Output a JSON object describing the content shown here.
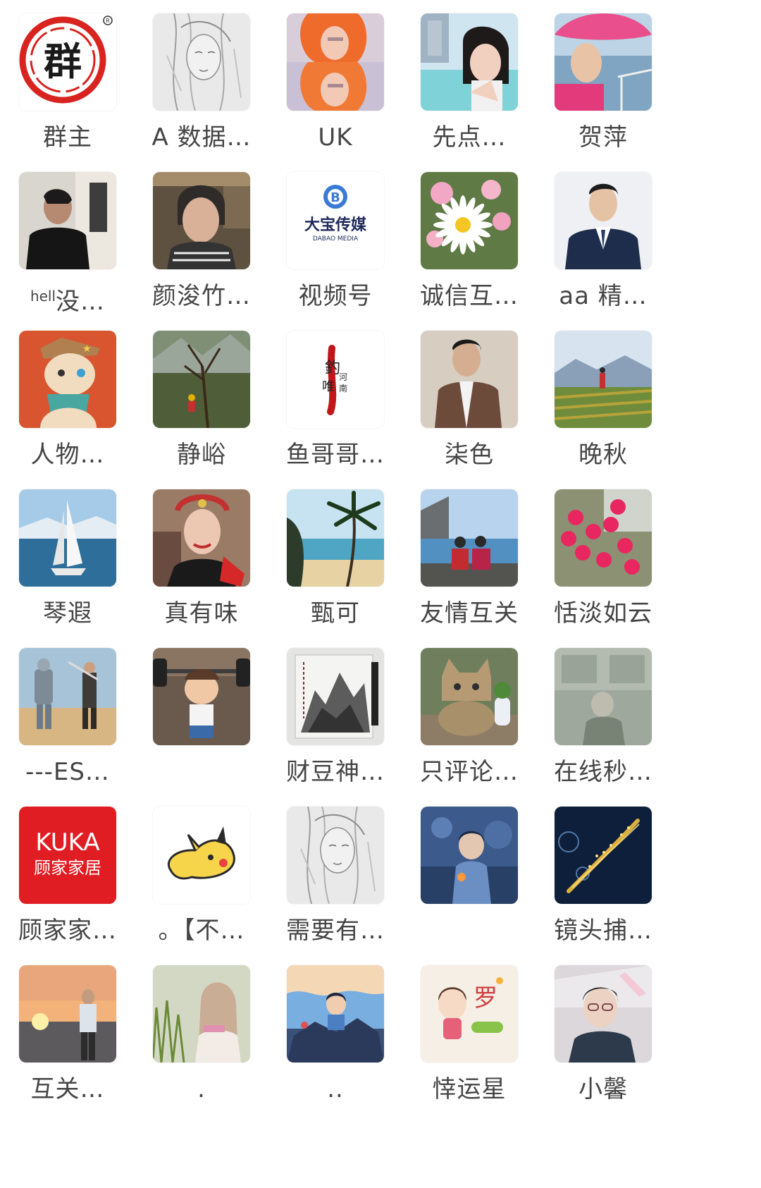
{
  "members": [
    {
      "name": "群主",
      "avatar": "group-owner-seal-logo"
    },
    {
      "name": "A 数据…",
      "avatar": "sketch-portrait"
    },
    {
      "name": "UK",
      "avatar": "orange-hair-portrait"
    },
    {
      "name": "先点…",
      "avatar": "woman-pool-portrait"
    },
    {
      "name": "贺萍",
      "avatar": "woman-pink-hat-portrait"
    },
    {
      "name_prefix": "hell",
      "name": "没…",
      "avatar": "man-window-portrait"
    },
    {
      "name": "颜浚竹…",
      "avatar": "woman-selfie-portrait"
    },
    {
      "name": "视频号",
      "avatar": "dabao-media-logo",
      "logo_text": "大宝传媒",
      "logo_sub": "DABAO    MEDIA",
      "logo_mark": "B"
    },
    {
      "name": "诚信互…",
      "avatar": "daisy-flowers"
    },
    {
      "name": "aa 精…",
      "avatar": "man-suit-portrait"
    },
    {
      "name": "人物…",
      "avatar": "cartoon-cat"
    },
    {
      "name": "静峪",
      "avatar": "hiker-landscape"
    },
    {
      "name": "鱼哥哥…",
      "avatar": "calligraphy-logo"
    },
    {
      "name": "柒色",
      "avatar": "man-blazer-portrait"
    },
    {
      "name": "晚秋",
      "avatar": "terrace-landscape"
    },
    {
      "name": "琴遐",
      "avatar": "sailboat"
    },
    {
      "name": "真有味",
      "avatar": "woman-headdress-portrait"
    },
    {
      "name": "甄可",
      "avatar": "palm-beach"
    },
    {
      "name": "友情互关",
      "avatar": "couple-seaside"
    },
    {
      "name": "恬淡如云",
      "avatar": "pink-blossoms"
    },
    {
      "name": "---ES…",
      "avatar": "robot-samurai"
    },
    {
      "name": "",
      "avatar": "cartoon-weightlifter"
    },
    {
      "name": "财豆神…",
      "avatar": "ink-painting"
    },
    {
      "name": "只评论…",
      "avatar": "tabby-cat"
    },
    {
      "name": "在线秒…",
      "avatar": "faded-bus-photo"
    },
    {
      "name": "顾家家…",
      "avatar": "kuka-logo",
      "logo_text": "KUKA",
      "logo_sub": "顾家家居"
    },
    {
      "name": "。【不…",
      "avatar": "pikachu-sticker"
    },
    {
      "name": "需要有…",
      "avatar": "sketch-portrait"
    },
    {
      "name": "",
      "avatar": "anime-boy-night"
    },
    {
      "name": "镜头捕…",
      "avatar": "golden-sparkle"
    },
    {
      "name": "互关…",
      "avatar": "man-sunset-sea"
    },
    {
      "name": ".",
      "avatar": "girl-grass"
    },
    {
      "name": "..",
      "avatar": "anime-boy-rocks"
    },
    {
      "name": "悻运星",
      "avatar": "cartoon-girl-lucky"
    },
    {
      "name": "小馨",
      "avatar": "woman-glasses-portrait"
    }
  ]
}
